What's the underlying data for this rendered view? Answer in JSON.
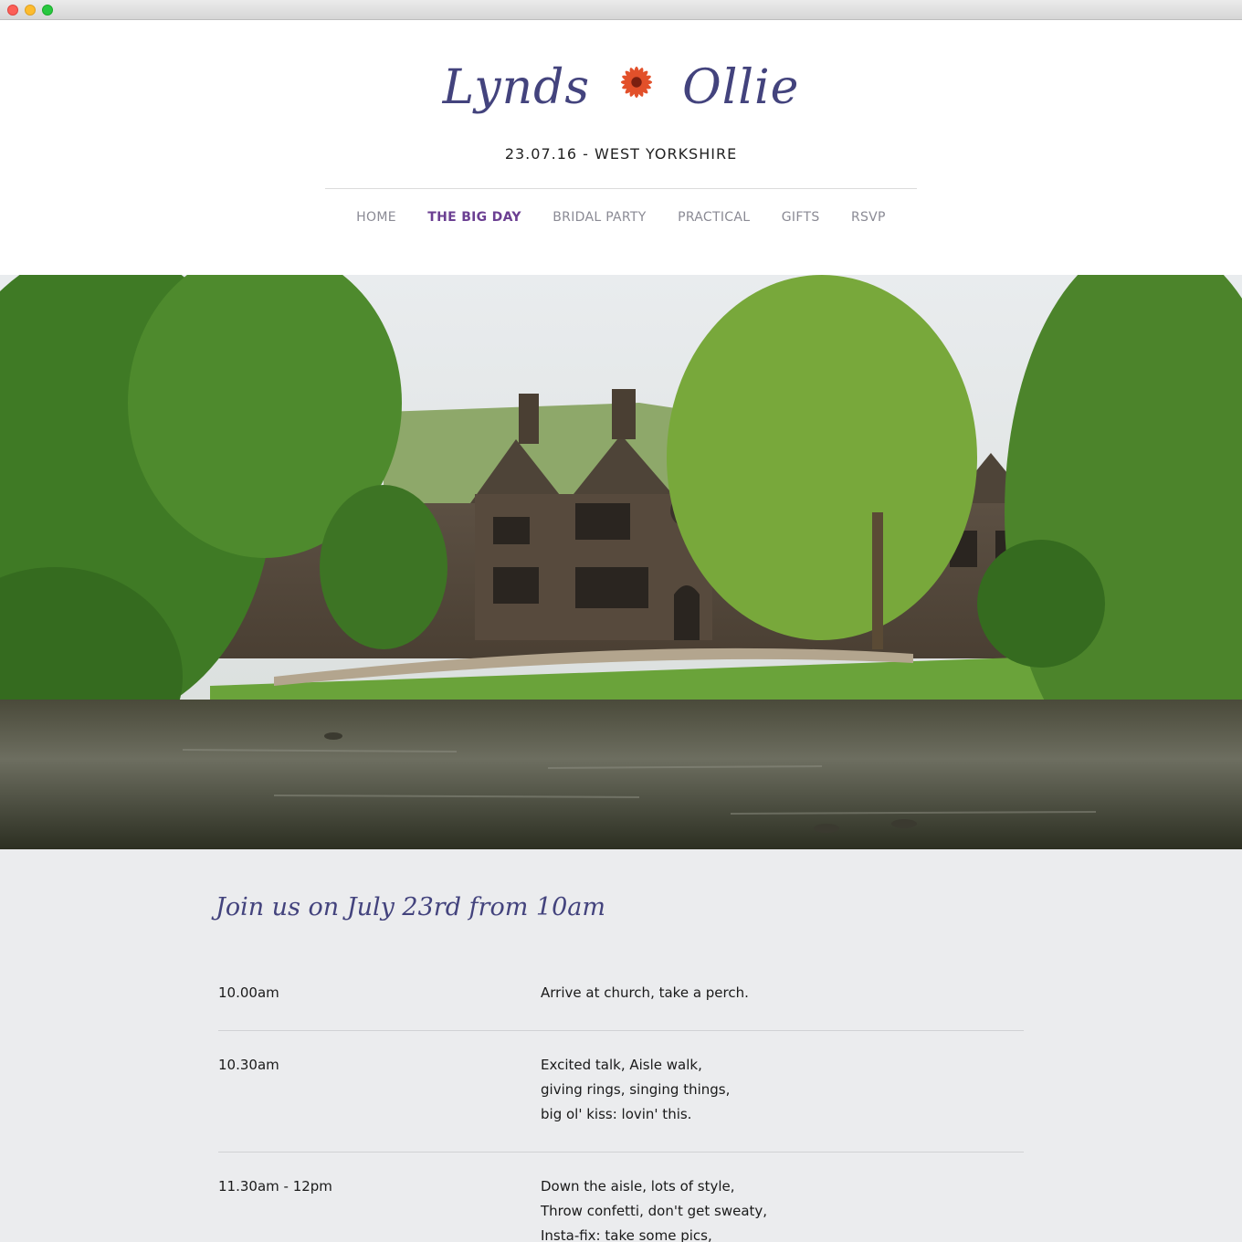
{
  "site": {
    "logo_left": "Lynds",
    "logo_right": "Ollie",
    "tagline": "23.07.16 - WEST YORKSHIRE"
  },
  "nav": {
    "items": [
      {
        "label": "HOME",
        "active": false
      },
      {
        "label": "THE BIG DAY",
        "active": true
      },
      {
        "label": "BRIDAL PARTY",
        "active": false
      },
      {
        "label": "PRACTICAL",
        "active": false
      },
      {
        "label": "GIFTS",
        "active": false
      },
      {
        "label": "RSVP",
        "active": false
      }
    ]
  },
  "schedule": {
    "title": "Join us on July 23rd from 10am",
    "rows": [
      {
        "time": "10.00am",
        "lines": [
          "Arrive at church, take a perch."
        ]
      },
      {
        "time": "10.30am",
        "lines": [
          "Excited talk, Aisle walk,",
          "giving rings, singing things,",
          "big ol' kiss: lovin' this."
        ]
      },
      {
        "time": "11.30am - 12pm",
        "lines": [
          "Down the aisle, lots of style,",
          "Throw confetti, don't get sweaty,",
          "Insta-fix: take some pics,"
        ]
      }
    ]
  },
  "colors": {
    "brand": "#43437d",
    "active_nav": "#6b3f92",
    "flower": "#e2502a"
  }
}
